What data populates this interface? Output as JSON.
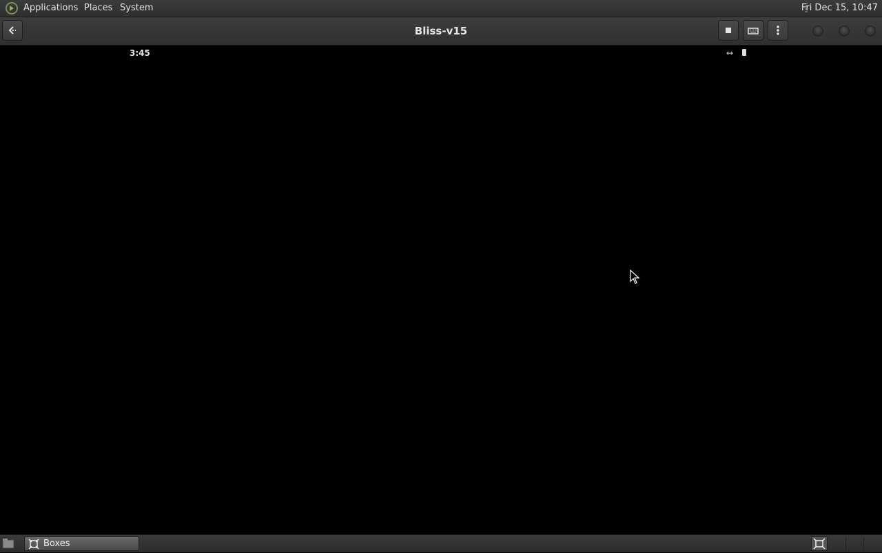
{
  "top_panel": {
    "menus": [
      "Applications",
      "Places",
      "System"
    ],
    "clock": "Fri Dec 15, 10:47"
  },
  "headerbar": {
    "title": "Bliss-v15"
  },
  "vm": {
    "time": "3:45",
    "status_icon": "↔"
  },
  "taskbar": {
    "window_label": "Boxes"
  },
  "icons": {
    "logo": "mate-logo-icon",
    "back": "back-arrow-icon",
    "stop": "stop-icon",
    "keyboard": "keyboard-icon",
    "menu": "kebab-menu-icon"
  }
}
